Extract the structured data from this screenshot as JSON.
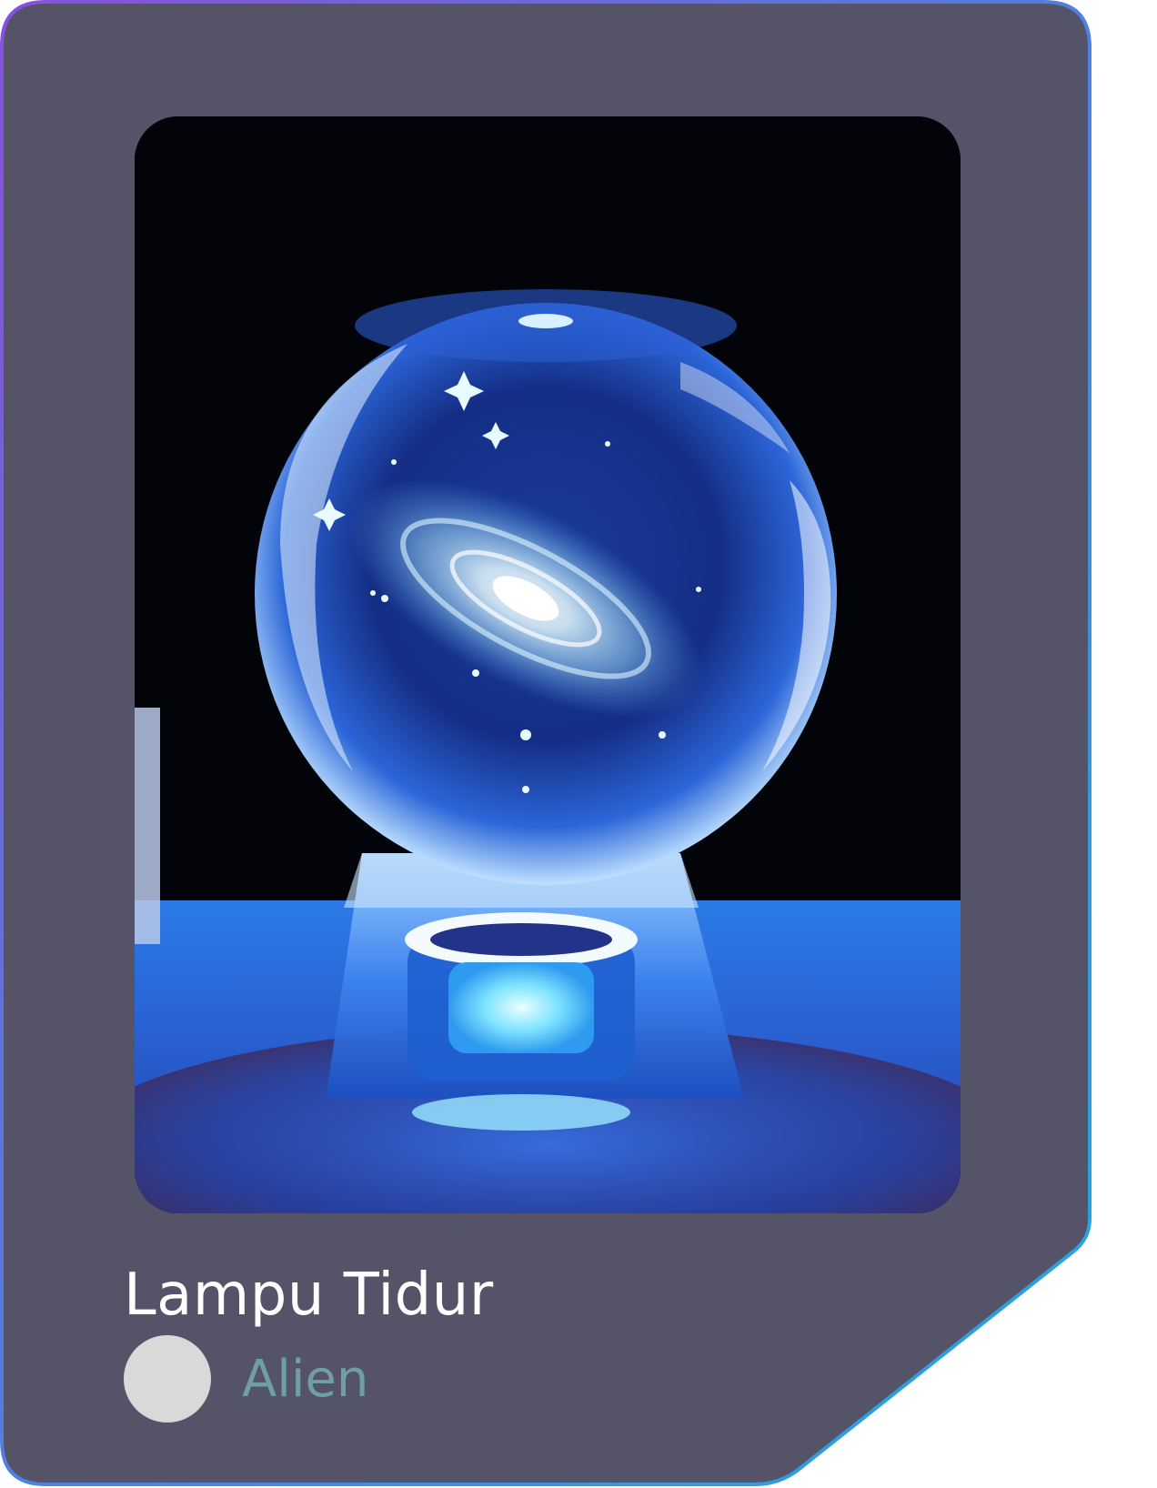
{
  "card": {
    "title": "Lampu Tidur",
    "author": {
      "name": "Alien",
      "avatar_color": "#d9d9d9"
    },
    "image": {
      "subject": "crystal-galaxy-ball-lamp-icon"
    },
    "colors": {
      "card_background": "#545368",
      "border_gradient_start": "#8a4fe0",
      "border_gradient_end": "#22a8e0",
      "title_color": "#ffffff",
      "author_color": "#6e9ea8"
    }
  }
}
